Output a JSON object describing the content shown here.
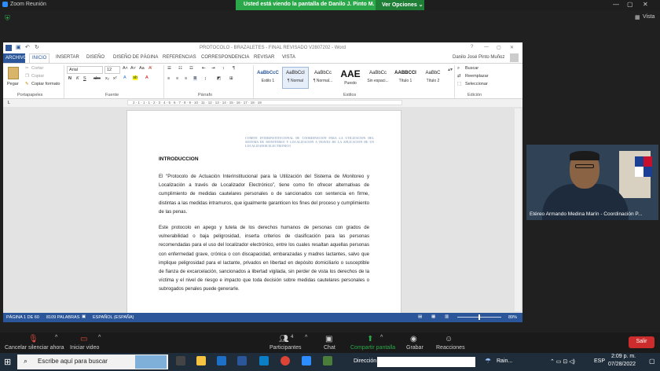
{
  "zoom": {
    "title": "Zoom Reunión",
    "banner_text": "Usted está viendo la pantalla de Danilo J. Pinto M.",
    "view_options": "Ver Opciones ⌄",
    "view_label": "Vista"
  },
  "word": {
    "title": "PROTOCOLO - BRAZALETES - FINAL REVISADO V2807202 - Word",
    "user": "Danilo José Pinto Muñoz",
    "menu": [
      "ARCHIVO",
      "INICIO",
      "INSERTAR",
      "DISEÑO",
      "DISEÑO DE PÁGINA",
      "REFERENCIAS",
      "CORRESPONDENCIA",
      "REVISAR",
      "VISTA"
    ],
    "clipboard": {
      "paste": "Pegar",
      "cut": "Cortar",
      "copy": "Copiar",
      "format": "Copiar formato",
      "label": "Portapapeles"
    },
    "font": {
      "name": "Arial",
      "size": "12",
      "label": "Fuente"
    },
    "paragraph_label": "Párrafo",
    "styles_label": "Estilos",
    "styles": [
      {
        "preview": "AaBbCcC",
        "name": "Estilo 1"
      },
      {
        "preview": "AaBbCcI",
        "name": "¶ Normal"
      },
      {
        "preview": "AaBbCc",
        "name": "¶ Normal..."
      },
      {
        "preview": "AAE",
        "name": "Puesto"
      },
      {
        "preview": "AaBbCc",
        "name": "Sin espaci..."
      },
      {
        "preview": "AABBCCI",
        "name": "Título 1"
      },
      {
        "preview": "AaBbC",
        "name": "Título 2"
      }
    ],
    "edit": {
      "search": "Buscar",
      "replace": "Reemplazar",
      "select": "Seleccionar",
      "label": "Edición"
    },
    "ruler_marks": "2 · 1 · 1 · 1 · 2 · 3 · 4 · 5 · 6 · 7 · 8 · 9 · 10 · 11 · 12 · 13 · 14 · 15 · 16 · 17 · 18 · 19",
    "watermark": "COMITE INTERINSTITUCIONAL DE COORDINACION PARA LA UTILIZACION DEL SISTEMA DE MONITOREO Y LOCALIZACION A TRAVES DE LA APLICACION DE UN LOCALIZADOR ELECTRONICO",
    "heading": "INTRODUCCION",
    "para1": "El “Protocolo de Actuación Interinstitucional para la Utilización del Sistema de Monitoreo y Localización a través de Localizador Electrónico”, tiene como fin ofrecer alternativas de cumplimiento de medidas cautelares personales o de sancionados con sentencia en firme, distintas a las medidas intramuros, que igualmente garanticen los fines del proceso y cumplimiento de las penas.",
    "para2": "Este protocolo en apego y tutela de los derechos humanos de personas con grados de vulnerabilidad o baja peligrosidad, inserta criterios de clasificación para las personas recomendadas para el uso del localizador electrónico, entre los cuales resaltan aquellas personas con enfermedad grave, crónica o con discapacidad, embarazadas y madres lactantes, salvo que implique peligrosidad para el lactante, privados en libertad en depósito domiciliario o susceptible de fianza de excarcelación, sancionados a libertad vigilada, sin perder de vista los derechos de la víctima y el nivel de riesgo e impacto que toda decisión sobre medidas cautelares personales o subrogados penales puede generarle.",
    "status": {
      "page": "PÁGINA 1 DE 60",
      "words": "8109 PALABRAS",
      "lang": "ESPAÑOL (ESPAÑA)",
      "zoom": "89%"
    }
  },
  "participant": {
    "name": "Etéreo Armando Medina Marín - Coordinación P..."
  },
  "toolbar": {
    "mute": "Cancelar silenciar ahora",
    "video": "Iniciar video",
    "participants": "Participantes",
    "participants_count": "4",
    "chat": "Chat",
    "share": "Compartir pantalla",
    "record": "Grabar",
    "reactions": "Reacciones",
    "leave": "Salir"
  },
  "taskbar": {
    "search": "Escribe aquí para buscar",
    "address_label": "Dirección",
    "weather": "Rain...",
    "lang": "ESP",
    "time": "2:09 p. m.",
    "date": "07/28/2022"
  }
}
